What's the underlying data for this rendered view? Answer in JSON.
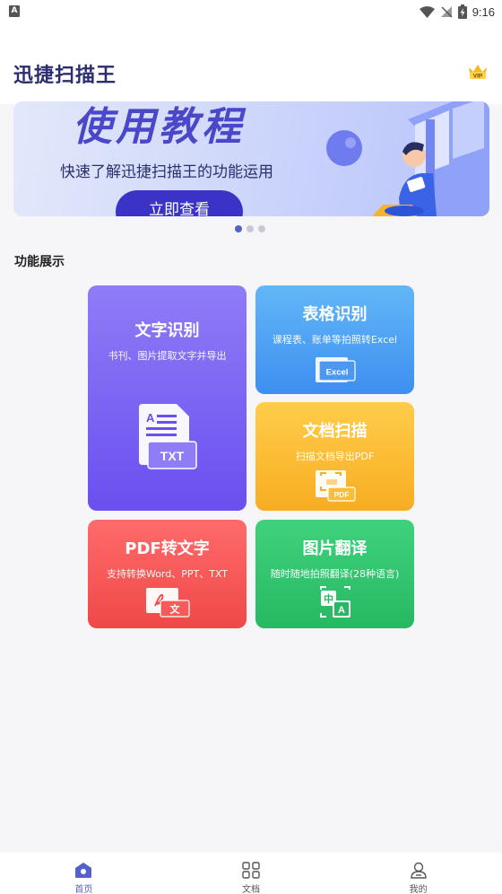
{
  "status_bar": {
    "app_badge": "A",
    "time": "9:16",
    "icons": [
      "wifi-icon",
      "signal-off-icon",
      "battery-charging-icon"
    ]
  },
  "header": {
    "title": "迅捷扫描王",
    "vip_label": "VIP"
  },
  "banner": {
    "heading": "使用教程",
    "subtitle": "快速了解迅捷扫描王的功能运用",
    "button_label": "立即查看",
    "page_count": 3,
    "active_page": 1
  },
  "features": {
    "section_title": "功能展示",
    "cards": [
      {
        "title": "文字识别",
        "desc": "书刊、图片提取文字并导出",
        "icon_label": "TXT",
        "color": "#7a63f4"
      },
      {
        "title": "表格识别",
        "desc": "课程表、账单等拍照转Excel",
        "icon_label": "Excel",
        "color": "#4ea4f4"
      },
      {
        "title": "文档扫描",
        "desc": "扫描文档导出PDF",
        "icon_label": "PDF",
        "color": "#fbbd34"
      },
      {
        "title": "PDF转文字",
        "desc": "支持转换Word、PPT、TXT",
        "icon_label": "文",
        "color": "#f75a5a"
      },
      {
        "title": "图片翻译",
        "desc": "随时随地拍照翻译(28种语言)",
        "icon_label_a": "中",
        "icon_label_b": "A",
        "color": "#33c56f"
      }
    ]
  },
  "bottom_nav": {
    "items": [
      {
        "label": "首页",
        "icon": "home-icon",
        "active": true
      },
      {
        "label": "文档",
        "icon": "grid-icon",
        "active": false
      },
      {
        "label": "我的",
        "icon": "user-icon",
        "active": false
      }
    ]
  },
  "colors": {
    "brand": "#2b2d6e",
    "accent": "#5560c8",
    "banner_button": "#3b33c7"
  }
}
